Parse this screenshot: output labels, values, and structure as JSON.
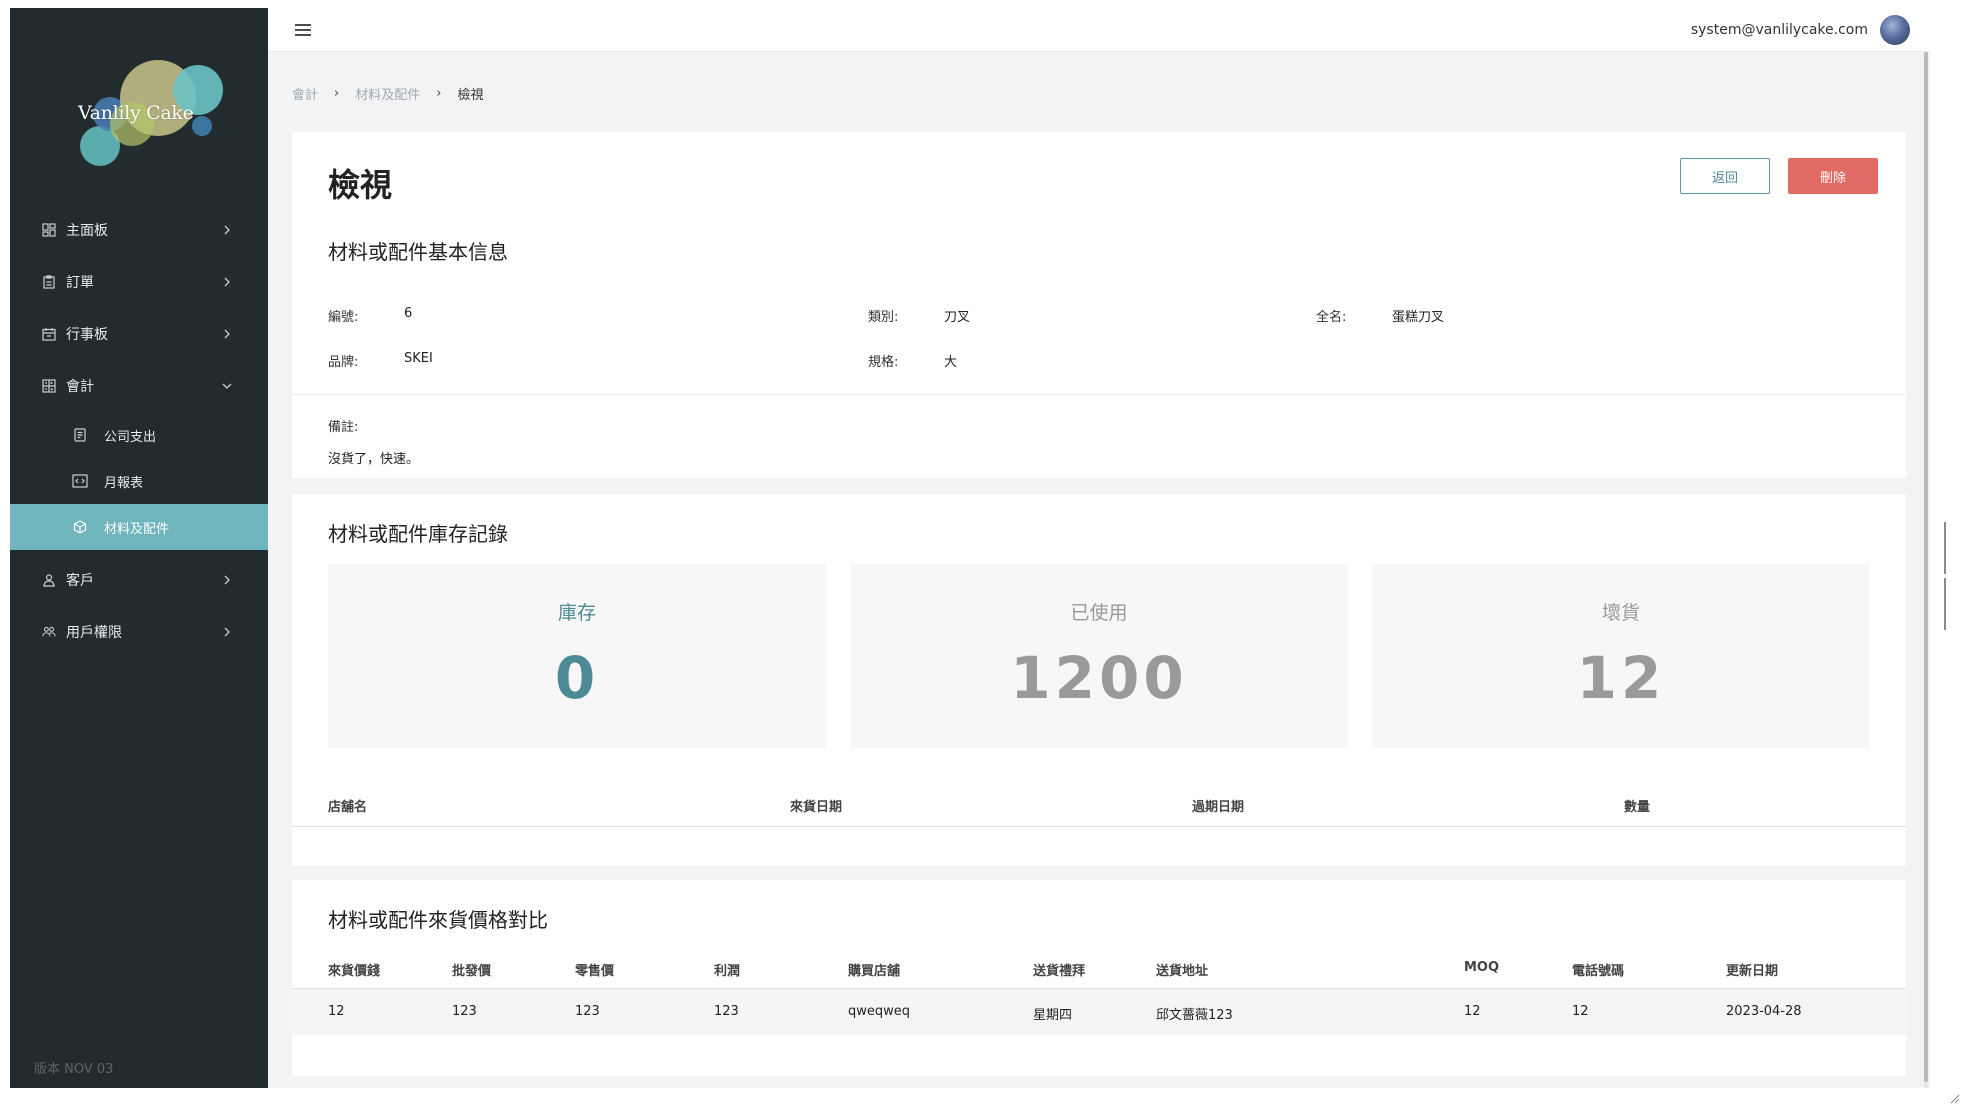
{
  "sidebar": {
    "logo_text": "Vanlily Cake",
    "items": [
      {
        "label": "主面板",
        "icon": "dashboard-icon"
      },
      {
        "label": "訂單",
        "icon": "clipboard-icon"
      },
      {
        "label": "行事板",
        "icon": "calendar-icon"
      },
      {
        "label": "會計",
        "icon": "calculator-icon",
        "expanded": true,
        "children": [
          {
            "label": "公司支出",
            "icon": "document-icon"
          },
          {
            "label": "月報表",
            "icon": "code-report-icon"
          },
          {
            "label": "材料及配件",
            "icon": "cube-icon",
            "active": true
          }
        ]
      },
      {
        "label": "客戶",
        "icon": "user-icon"
      },
      {
        "label": "用戶權限",
        "icon": "users-icon"
      }
    ],
    "version": "版本  NOV 03"
  },
  "header": {
    "user_email": "system@vanlilycake.com"
  },
  "breadcrumb": {
    "items": [
      "會計",
      "材料及配件"
    ],
    "separator": "›",
    "current": "檢視"
  },
  "detail": {
    "title": "檢視",
    "back_label": "返回",
    "delete_label": "刪除",
    "section_title": "材料或配件基本信息",
    "fields": {
      "code_label": "編號:",
      "code_value": "6",
      "category_label": "類別:",
      "category_value": "刀叉",
      "fullname_label": "全名:",
      "fullname_value": "蛋糕刀叉",
      "brand_label": "品牌:",
      "brand_value": "SKEI",
      "spec_label": "規格:",
      "spec_value": "大"
    },
    "note_label": "備註:",
    "note_value": "沒貨了，快速。"
  },
  "inventory": {
    "section_title": "材料或配件庫存記錄",
    "stats": [
      {
        "label": "庫存",
        "value": "0",
        "color": "#4e8a96"
      },
      {
        "label": "已使用",
        "value": "1200",
        "color": "#9a9a9a"
      },
      {
        "label": "壞貨",
        "value": "12",
        "color": "#9a9a9a"
      }
    ],
    "columns": [
      "店舖名",
      "來貨日期",
      "過期日期",
      "數量"
    ]
  },
  "prices": {
    "section_title": "材料或配件來貨價格對比",
    "columns": [
      "來貨價錢",
      "批發價",
      "零售價",
      "利潤",
      "購買店舖",
      "送貨禮拜",
      "送貨地址",
      "MOQ",
      "電話號碼",
      "更新日期"
    ],
    "rows": [
      [
        "12",
        "123",
        "123",
        "123",
        "qweqweq",
        "星期四",
        "邱文薔薇123",
        "12",
        "12",
        "2023-04-28"
      ]
    ]
  },
  "colors": {
    "sidebar_bg": "#222b2e",
    "active_bg": "#6fb5bd",
    "accent": "#4e8a96",
    "danger": "#e06a64"
  }
}
